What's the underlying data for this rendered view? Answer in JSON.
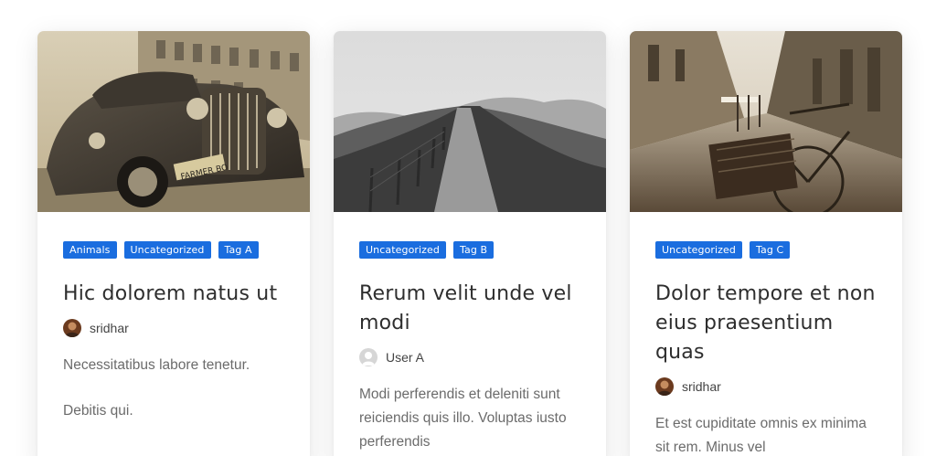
{
  "colors": {
    "tag_bg": "#1a6ddf",
    "title": "#2e2e2e",
    "text": "#6b6b6b"
  },
  "cards": [
    {
      "image": "vintage-car-photo",
      "tags": [
        "Animals",
        "Uncategorized",
        "Tag A"
      ],
      "title": "Hic dolorem natus ut",
      "author": {
        "name": "sridhar",
        "avatar": "photo-avatar"
      },
      "excerpt": [
        "Necessitatibus labore tenetur.",
        "Debitis qui."
      ]
    },
    {
      "image": "hill-path-photo",
      "tags": [
        "Uncategorized",
        "Tag B"
      ],
      "title": "Rerum velit unde vel modi",
      "author": {
        "name": "User A",
        "avatar": "default-avatar"
      },
      "excerpt": [
        "Modi perferendis et deleniti sunt reiciendis quis illo. Voluptas iusto perferendis"
      ]
    },
    {
      "image": "street-bicycle-photo",
      "tags": [
        "Uncategorized",
        "Tag C"
      ],
      "title": "Dolor tempore et non eius praesentium quas",
      "author": {
        "name": "sridhar",
        "avatar": "photo-avatar"
      },
      "excerpt": [
        "Et est cupiditate omnis ex minima sit rem. Minus vel"
      ]
    }
  ]
}
